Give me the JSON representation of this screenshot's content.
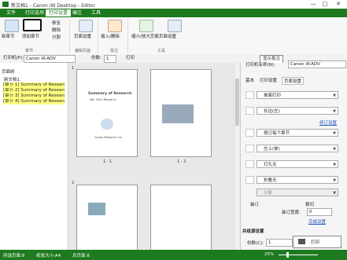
{
  "title": "新文档1 - Canon iW Desktop - Editor",
  "window_controls": {
    "minimize": "—",
    "maximize": "□",
    "close": "✕"
  },
  "menu": [
    "文件",
    "打印选项",
    "打印设置",
    "编注",
    "工具"
  ],
  "ribbon": {
    "new_chapter": "新章节",
    "insert": "添加章节",
    "move_to": "移至",
    "split": "分割",
    "delete_label": "删除",
    "page_settings": "页面设置",
    "insert_annot": "插入/删除",
    "zoom": "缩小/放大页面",
    "edit_pages": "页面设置",
    "group_chapter": "章节",
    "group_page_edit": "编辑页面",
    "group_annot": "批注",
    "group_tools": "工具"
  },
  "toolbar": {
    "printer_label": "打印机(P):",
    "printer_value": "Canon iR-ADV",
    "copies_label": "份数:",
    "copies_value": "1",
    "print_label": "打印",
    "show_notes": "显示批注"
  },
  "left_panel": {
    "title": "页面树",
    "root": "新文档1",
    "items": [
      "[章节 1] Summary of Research",
      "[章节 2] Summary of Research",
      "[章节 3] Summary of Research",
      "[章节 4] Summary of Research"
    ]
  },
  "main": {
    "section_num_1": "1",
    "section_num_2": "2",
    "page_labels": [
      "1 - 1",
      "1 - 2"
    ],
    "page1_title": "Summary of Research",
    "page1_subtitle": "Mar 2020 Research",
    "page1_org": "Canon Research Inc."
  },
  "right_panel": {
    "printer_label": "打印机名称(N):",
    "printer_value": "Canon iR-ADV",
    "tabs": [
      "基本",
      "打印设置",
      "页面设置"
    ],
    "options": [
      "单面打印",
      "长边(左)",
      "按订每个章节",
      "左上(单)",
      "打孔无",
      "折叠无",
      "分册"
    ],
    "links": [
      "修订设置",
      "完成设置"
    ],
    "check1": "装订",
    "check2": "裁切",
    "bind_label": "装订宽度:",
    "bind_value": "0",
    "section": "共纸源设置",
    "copies_label": "份数(C):",
    "copies_value": "1",
    "print_btn": "打印"
  },
  "status": {
    "pages": "所选页面:8",
    "size": "纸张大小:A4",
    "total": "总页面:8",
    "zoom": "25%"
  },
  "colors": {
    "accent": "#1e7a1e",
    "highlight": "#ffff80"
  }
}
